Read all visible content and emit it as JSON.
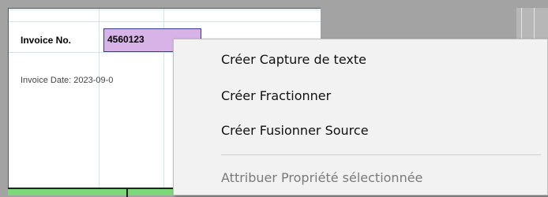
{
  "document": {
    "invoice_no_label": "Invoice No.",
    "invoice_no_value": "4560123",
    "invoice_date_text": "Invoice Date: 2023-09-0"
  },
  "context_menu": {
    "items": [
      {
        "label": "Créer Capture de texte",
        "enabled": true
      },
      {
        "label": "Créer Fractionner",
        "enabled": true
      },
      {
        "label": "Créer Fusionner Source",
        "enabled": true
      },
      {
        "label": "Attribuer Propriété sélectionnée",
        "enabled": false
      }
    ]
  },
  "colors": {
    "field_highlight": "#d8b3e8",
    "table_header_green": "#7dd87a",
    "menu_background": "#f2f2f2"
  }
}
